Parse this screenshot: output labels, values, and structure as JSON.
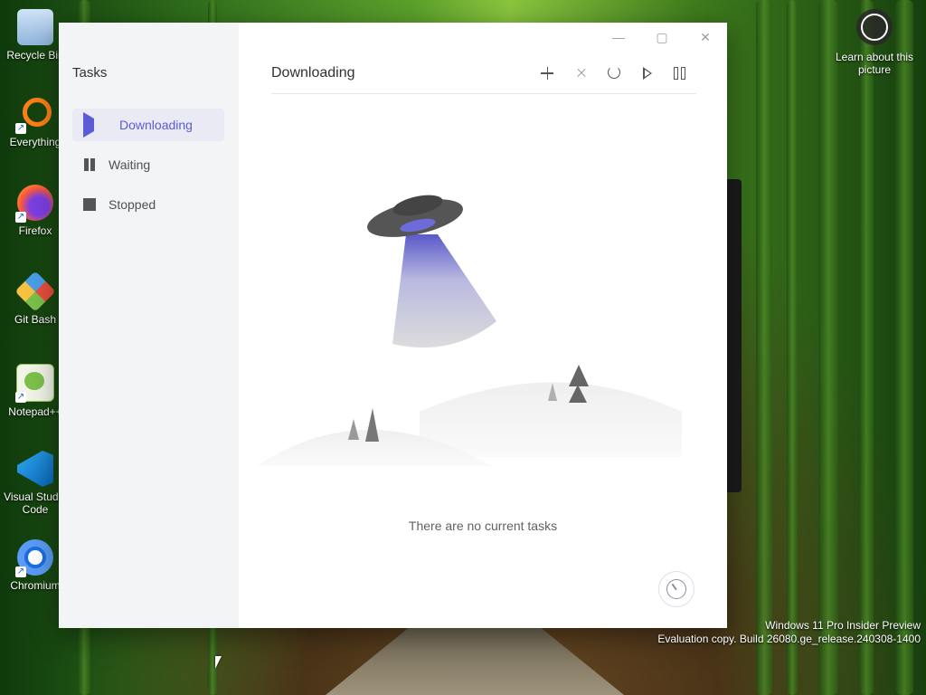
{
  "desktop": {
    "icons": [
      {
        "label": "Recycle Bin",
        "icon": "recycle-bin-icon"
      },
      {
        "label": "Everything",
        "icon": "everything-icon"
      },
      {
        "label": "Firefox",
        "icon": "firefox-icon"
      },
      {
        "label": "Git Bash",
        "icon": "git-bash-icon"
      },
      {
        "label": "Notepad++",
        "icon": "notepadpp-icon"
      },
      {
        "label": "Visual Studio Code",
        "icon": "vscode-icon"
      },
      {
        "label": "Chromium",
        "icon": "chromium-icon"
      }
    ],
    "learn_about": "Learn about this picture",
    "watermark": {
      "line1": "Windows 11 Pro Insider Preview",
      "line2": "Evaluation copy. Build 26080.ge_release.240308-1400"
    }
  },
  "app": {
    "sidebar": {
      "title": "Tasks",
      "items": [
        {
          "label": "Downloading",
          "icon": "play-icon",
          "active": true
        },
        {
          "label": "Waiting",
          "icon": "pause-icon",
          "active": false
        },
        {
          "label": "Stopped",
          "icon": "stop-icon",
          "active": false
        }
      ]
    },
    "window_controls": [
      "minimize-icon",
      "maximize-icon",
      "close-icon"
    ],
    "header": {
      "title": "Downloading",
      "tools": [
        "add-icon",
        "delete-icon",
        "refresh-icon",
        "resume-icon",
        "pause-all-icon"
      ]
    },
    "empty_text": "There are no current tasks",
    "colors": {
      "accent": "#5b5bd6",
      "sidebar_bg": "#f3f4f6"
    }
  }
}
